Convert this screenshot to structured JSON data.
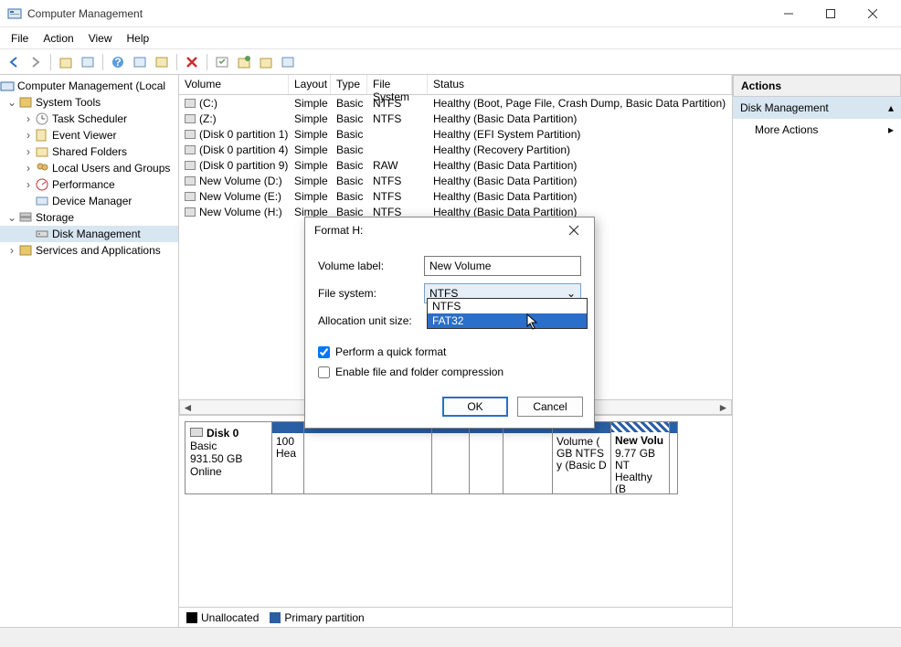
{
  "window": {
    "title": "Computer Management"
  },
  "menus": [
    "File",
    "Action",
    "View",
    "Help"
  ],
  "tree": {
    "root": "Computer Management (Local",
    "system_tools": "System Tools",
    "task_scheduler": "Task Scheduler",
    "event_viewer": "Event Viewer",
    "shared_folders": "Shared Folders",
    "local_users": "Local Users and Groups",
    "performance": "Performance",
    "device_manager": "Device Manager",
    "storage": "Storage",
    "disk_management": "Disk Management",
    "services": "Services and Applications"
  },
  "columns": {
    "volume": "Volume",
    "layout": "Layout",
    "type": "Type",
    "filesystem": "File System",
    "status": "Status"
  },
  "col_widths": {
    "volume": 120,
    "layout": 46,
    "type": 40,
    "filesystem": 66,
    "status": 320
  },
  "volumes": [
    {
      "name": "(C:)",
      "layout": "Simple",
      "type": "Basic",
      "fs": "NTFS",
      "status": "Healthy (Boot, Page File, Crash Dump, Basic Data Partition)"
    },
    {
      "name": "(Z:)",
      "layout": "Simple",
      "type": "Basic",
      "fs": "NTFS",
      "status": "Healthy (Basic Data Partition)"
    },
    {
      "name": "(Disk 0 partition 1)",
      "layout": "Simple",
      "type": "Basic",
      "fs": "",
      "status": "Healthy (EFI System Partition)"
    },
    {
      "name": "(Disk 0 partition 4)",
      "layout": "Simple",
      "type": "Basic",
      "fs": "",
      "status": "Healthy (Recovery Partition)"
    },
    {
      "name": "(Disk 0 partition 9)",
      "layout": "Simple",
      "type": "Basic",
      "fs": "RAW",
      "status": "Healthy (Basic Data Partition)"
    },
    {
      "name": "New Volume (D:)",
      "layout": "Simple",
      "type": "Basic",
      "fs": "NTFS",
      "status": "Healthy (Basic Data Partition)"
    },
    {
      "name": "New Volume (E:)",
      "layout": "Simple",
      "type": "Basic",
      "fs": "NTFS",
      "status": "Healthy (Basic Data Partition)"
    },
    {
      "name": "New Volume (H:)",
      "layout": "Simple",
      "type": "Basic",
      "fs": "NTFS",
      "status": "Healthy (Basic Data Partition)"
    }
  ],
  "disk_map": {
    "disk_label": "Disk 0",
    "disk_type": "Basic",
    "disk_size": "931.50 GB",
    "disk_status": "Online",
    "p0": {
      "l1": "100",
      "l2": "Hea"
    },
    "p5": {
      "l1": "Volume (",
      "l2": "GB NTFS",
      "l3": "y (Basic D"
    },
    "p6": {
      "l1": "New Volu",
      "l2": "9.77 GB NT",
      "l3": "Healthy (B"
    }
  },
  "legend": {
    "unallocated": "Unallocated",
    "primary": "Primary partition"
  },
  "actions": {
    "header": "Actions",
    "main": "Disk Management",
    "more": "More Actions"
  },
  "dialog": {
    "title": "Format H:",
    "volume_label_lbl": "Volume label:",
    "volume_label_val": "New Volume",
    "filesystem_lbl": "File system:",
    "filesystem_val": "NTFS",
    "alloc_lbl": "Allocation unit size:",
    "quick_format": "Perform a quick format",
    "compression": "Enable file and folder compression",
    "ok": "OK",
    "cancel": "Cancel",
    "options": [
      "NTFS",
      "FAT32"
    ]
  }
}
